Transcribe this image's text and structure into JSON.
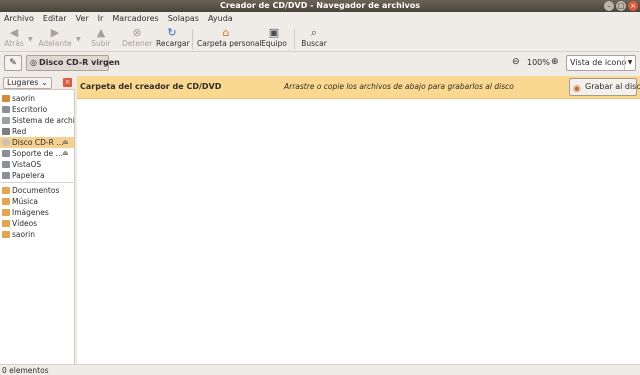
{
  "window": {
    "title": "Creador de CD/DVD - Navegador de archivos"
  },
  "menu": [
    "Archivo",
    "Editar",
    "Ver",
    "Ir",
    "Marcadores",
    "Solapas",
    "Ayuda"
  ],
  "toolbar": {
    "back": "Atrás",
    "forward": "Adelante",
    "up": "Subir",
    "stop": "Detener",
    "reload": "Recargar",
    "home": "Carpeta personal",
    "computer": "Equipo",
    "search": "Buscar"
  },
  "location": {
    "path_button": "Disco CD-R virgen",
    "zoom": "100%",
    "view_mode": "Vista de icono"
  },
  "sidebar": {
    "header": "Lugares",
    "places": [
      {
        "label": "saorin",
        "icon": "home-folder-icon",
        "color": "#d08a3a"
      },
      {
        "label": "Escritorio",
        "icon": "desktop-icon",
        "color": "#8a8f98"
      },
      {
        "label": "Sistema de archi…",
        "icon": "filesystem-icon",
        "color": "#9aa0a6"
      },
      {
        "label": "Red",
        "icon": "network-icon",
        "color": "#7a7f86"
      },
      {
        "label": "Disco CD-R …",
        "icon": "cd-icon",
        "color": "#c9c2b7"
      },
      {
        "label": "Soporte de …",
        "icon": "drive-icon",
        "color": "#8a8f98"
      },
      {
        "label": "VistaOS",
        "icon": "drive-icon",
        "color": "#8a8f98"
      },
      {
        "label": "Papelera",
        "icon": "trash-icon",
        "color": "#8a8f98"
      }
    ],
    "bookmarks": [
      {
        "label": "Documentos",
        "icon": "folder-icon",
        "color": "#e3a64f"
      },
      {
        "label": "Música",
        "icon": "folder-icon",
        "color": "#e3a64f"
      },
      {
        "label": "Imágenes",
        "icon": "folder-icon",
        "color": "#e3a64f"
      },
      {
        "label": "Vídeos",
        "icon": "folder-icon",
        "color": "#e3a64f"
      },
      {
        "label": "saorin",
        "icon": "folder-icon",
        "color": "#e3a64f"
      }
    ]
  },
  "banner": {
    "title": "Carpeta del creador de CD/DVD",
    "hint": "Arrastre o copie los archivos de abajo para grabarlos al disco",
    "burn_button": "Grabar al disco"
  },
  "status": "0 elementos",
  "colors": {
    "banner": "#fbd88f",
    "selection": "#f5d08f",
    "titlebar": "#4a443b"
  }
}
